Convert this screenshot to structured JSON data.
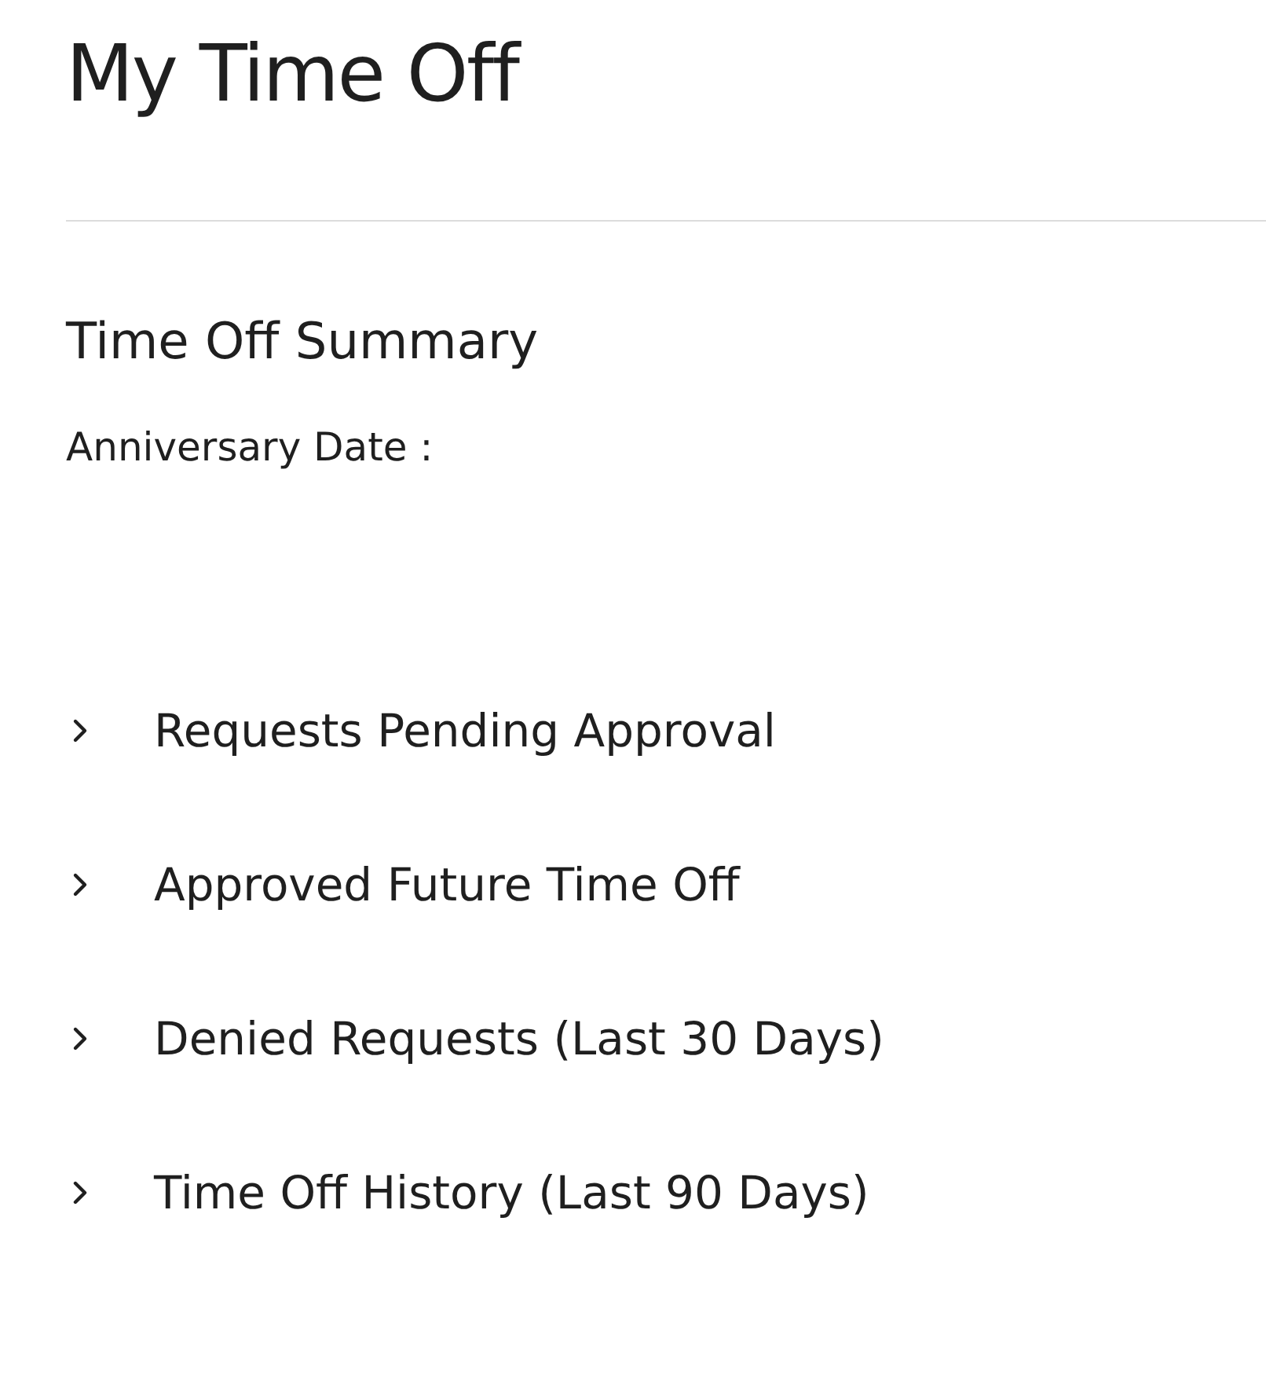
{
  "page": {
    "title": "My Time Off"
  },
  "summary": {
    "heading": "Time Off Summary",
    "anniversary_label": "Anniversary Date :"
  },
  "sections": [
    {
      "label": "Requests Pending Approval",
      "expanded": false
    },
    {
      "label": "Approved Future Time Off",
      "expanded": false
    },
    {
      "label": "Denied Requests (Last 30 Days)",
      "expanded": false
    },
    {
      "label": "Time Off History (Last 90 Days)",
      "expanded": false
    }
  ]
}
